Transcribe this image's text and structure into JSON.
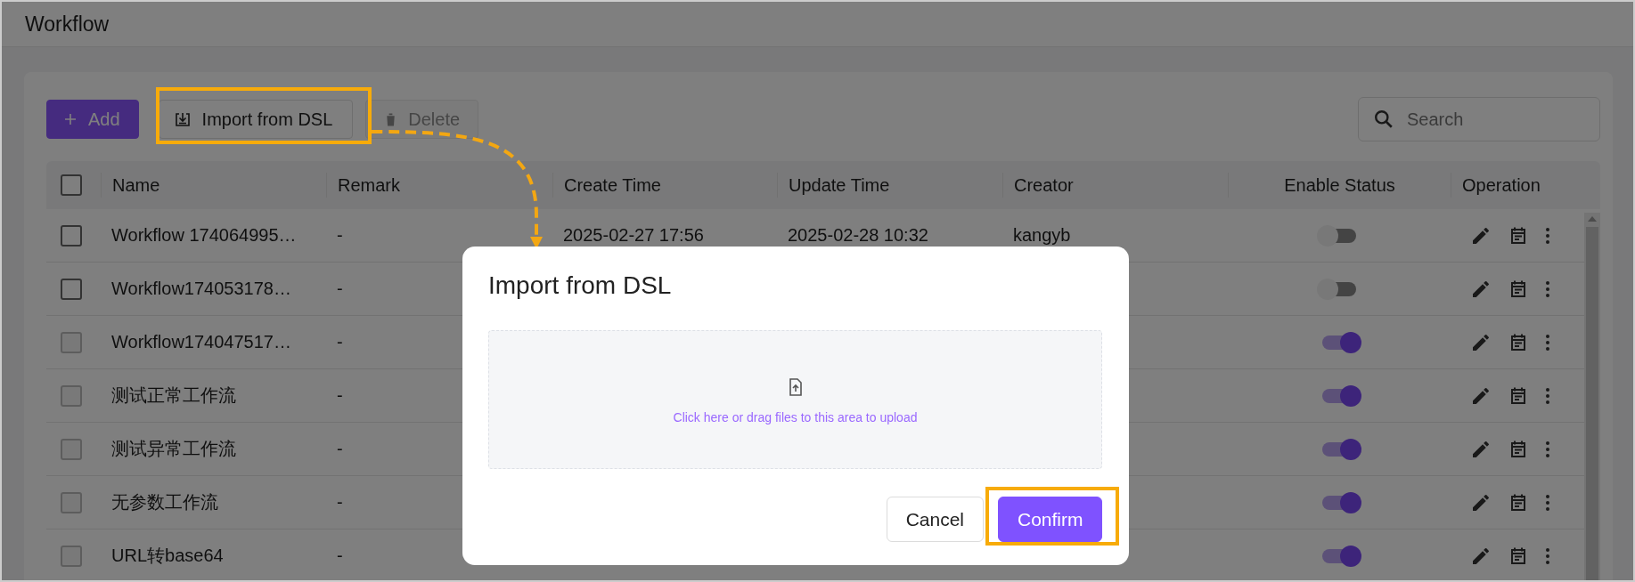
{
  "header": {
    "title": "Workflow"
  },
  "toolbar": {
    "add": "Add",
    "import": "Import from DSL",
    "delete": {
      "label": "Delete",
      "disabled": true
    },
    "search": {
      "placeholder": "Search"
    }
  },
  "table": {
    "select_all_checked": false,
    "columns": [
      "Name",
      "Remark",
      "Create Time",
      "Update Time",
      "Creator",
      "Enable Status",
      "Operation"
    ],
    "rows": [
      {
        "name": "Workflow 174064995…",
        "remark": "-",
        "create_time": "2025-02-27 17:56",
        "update_time": "2025-02-28 10:32",
        "creator": "kangyb",
        "checkbox_disabled": false,
        "enabled": false
      },
      {
        "name": "Workflow174053178…",
        "remark": "-",
        "checkbox_disabled": false,
        "enabled": false
      },
      {
        "name": "Workflow174047517…",
        "remark": "-",
        "checkbox_disabled": true,
        "enabled": true
      },
      {
        "name": "测试正常工作流",
        "remark": "-",
        "checkbox_disabled": true,
        "enabled": true
      },
      {
        "name": "测试异常工作流",
        "remark": "-",
        "checkbox_disabled": true,
        "enabled": true
      },
      {
        "name": "无参数工作流",
        "remark": "-",
        "checkbox_disabled": true,
        "enabled": true
      },
      {
        "name": "URL转base64",
        "remark": "-",
        "checkbox_disabled": true,
        "enabled": true
      }
    ]
  },
  "dialog": {
    "title": "Import from DSL",
    "upload_hint": "Click here or drag files to this area to upload",
    "buttons": [
      {
        "label": "Cancel",
        "kind": "secondary"
      },
      {
        "label": "Confirm",
        "kind": "primary"
      }
    ]
  }
}
